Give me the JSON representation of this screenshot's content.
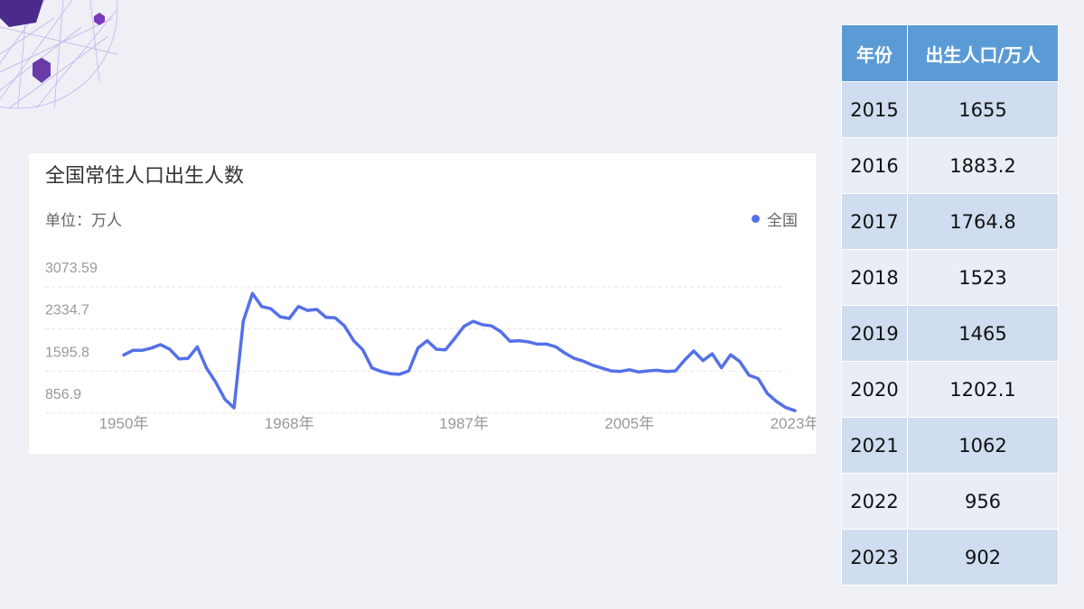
{
  "colors": {
    "line": "#5470e8",
    "table_header": "#5b9bd5",
    "grid": "#e6e6e6",
    "tick_text": "#999999"
  },
  "chart_data": {
    "type": "line",
    "title": "全国常住人口出生人数",
    "unit_label": "单位：万人",
    "legend_label": "全国",
    "legend_position": "top-right",
    "grid": true,
    "x": [
      1950,
      1951,
      1952,
      1953,
      1954,
      1955,
      1956,
      1957,
      1958,
      1959,
      1960,
      1961,
      1962,
      1963,
      1964,
      1965,
      1966,
      1967,
      1968,
      1969,
      1970,
      1971,
      1972,
      1973,
      1974,
      1975,
      1976,
      1977,
      1978,
      1979,
      1980,
      1981,
      1982,
      1983,
      1984,
      1985,
      1986,
      1987,
      1988,
      1989,
      1990,
      1991,
      1992,
      1993,
      1994,
      1995,
      1996,
      1997,
      1998,
      1999,
      2000,
      2001,
      2002,
      2003,
      2004,
      2005,
      2006,
      2007,
      2008,
      2009,
      2010,
      2011,
      2012,
      2013,
      2014,
      2015,
      2016,
      2017,
      2018,
      2019,
      2020,
      2021,
      2022,
      2023
    ],
    "x_tick_labels": [
      "1950年",
      "1968年",
      "1987年",
      "2005年",
      "2023年"
    ],
    "x_tick_values": [
      1950,
      1968,
      1987,
      2005,
      2023
    ],
    "y_ticks": [
      856.9,
      1595.8,
      2334.7,
      3073.59
    ],
    "y_tick_labels": [
      "856.9",
      "1595.8",
      "2334.7",
      "3073.59"
    ],
    "ylim": [
      856.9,
      3073.59
    ],
    "series": [
      {
        "name": "全国",
        "values": [
          1880,
          1960,
          1960,
          2000,
          2060,
          1980,
          1810,
          1820,
          2020,
          1650,
          1400,
          1100,
          950,
          2470,
          2960,
          2730,
          2690,
          2550,
          2520,
          2730,
          2660,
          2680,
          2540,
          2530,
          2390,
          2130,
          1970,
          1650,
          1590,
          1550,
          1540,
          1600,
          2000,
          2130,
          1980,
          1970,
          2170,
          2380,
          2470,
          2410,
          2390,
          2290,
          2120,
          2130,
          2110,
          2070,
          2070,
          2020,
          1910,
          1820,
          1770,
          1700,
          1650,
          1600,
          1590,
          1620,
          1580,
          1600,
          1610,
          1590,
          1600,
          1790,
          1950,
          1780,
          1900,
          1655,
          1883.2,
          1764.8,
          1523,
          1465,
          1202.1,
          1062,
          956,
          902
        ]
      }
    ]
  },
  "table": {
    "headers": [
      "年份",
      "出生人口/万人"
    ],
    "rows": [
      [
        "2015",
        "1655"
      ],
      [
        "2016",
        "1883.2"
      ],
      [
        "2017",
        "1764.8"
      ],
      [
        "2018",
        "1523"
      ],
      [
        "2019",
        "1465"
      ],
      [
        "2020",
        "1202.1"
      ],
      [
        "2021",
        "1062"
      ],
      [
        "2022",
        "956"
      ],
      [
        "2023",
        "902"
      ]
    ]
  }
}
